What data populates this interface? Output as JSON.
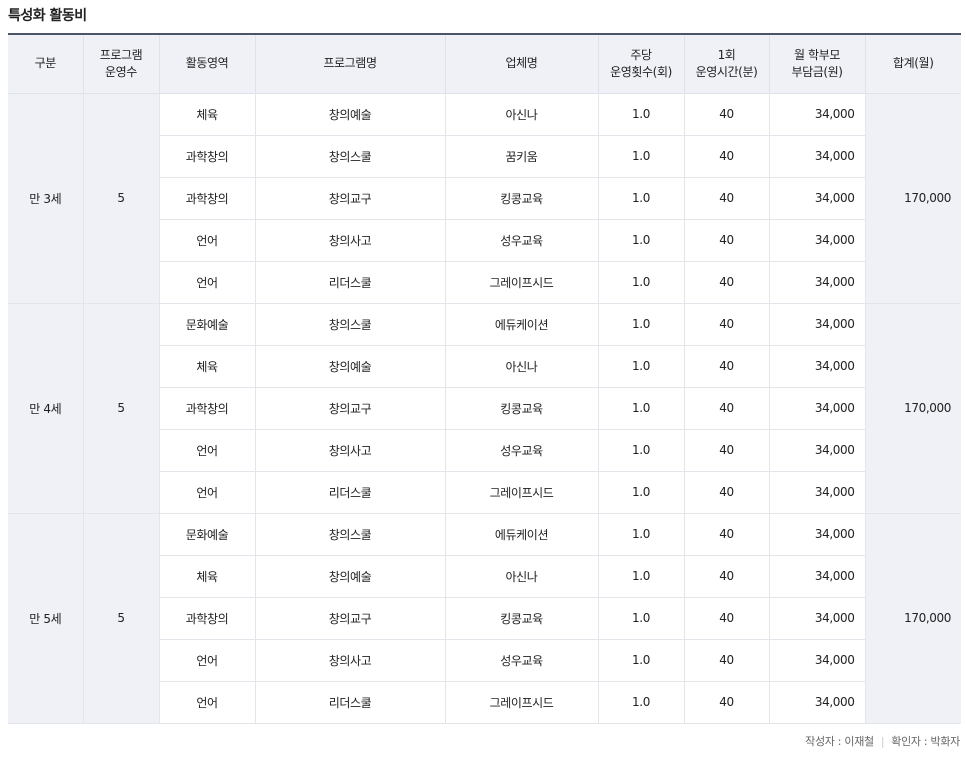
{
  "title": "특성화 활동비",
  "headers": {
    "gubun": "구분",
    "prog_count": [
      "프로그램",
      "운영수"
    ],
    "area": "활동영역",
    "program": "프로그램명",
    "vendor": "업체명",
    "weekly": [
      "주당",
      "운영횟수(회)"
    ],
    "duration": [
      "1회",
      "운영시간(분)"
    ],
    "fee": [
      "월 학부모",
      "부담금(원)"
    ],
    "total": "합계(월)"
  },
  "groups": [
    {
      "label": "만 3세",
      "count": "5",
      "total": "170,000",
      "rows": [
        {
          "area": "체육",
          "program": "창의예술",
          "vendor": "아신나",
          "weekly": "1.0",
          "duration": "40",
          "fee": "34,000"
        },
        {
          "area": "과학창의",
          "program": "창의스쿨",
          "vendor": "꿈키움",
          "weekly": "1.0",
          "duration": "40",
          "fee": "34,000"
        },
        {
          "area": "과학창의",
          "program": "창의교구",
          "vendor": "킹콩교육",
          "weekly": "1.0",
          "duration": "40",
          "fee": "34,000"
        },
        {
          "area": "언어",
          "program": "창의사고",
          "vendor": "성우교육",
          "weekly": "1.0",
          "duration": "40",
          "fee": "34,000"
        },
        {
          "area": "언어",
          "program": "리더스쿨",
          "vendor": "그레이프시드",
          "weekly": "1.0",
          "duration": "40",
          "fee": "34,000"
        }
      ]
    },
    {
      "label": "만 4세",
      "count": "5",
      "total": "170,000",
      "rows": [
        {
          "area": "문화예술",
          "program": "창의스쿨",
          "vendor": "에듀케이션",
          "weekly": "1.0",
          "duration": "40",
          "fee": "34,000"
        },
        {
          "area": "체육",
          "program": "창의예술",
          "vendor": "아신나",
          "weekly": "1.0",
          "duration": "40",
          "fee": "34,000"
        },
        {
          "area": "과학창의",
          "program": "창의교구",
          "vendor": "킹콩교육",
          "weekly": "1.0",
          "duration": "40",
          "fee": "34,000"
        },
        {
          "area": "언어",
          "program": "창의사고",
          "vendor": "성우교육",
          "weekly": "1.0",
          "duration": "40",
          "fee": "34,000"
        },
        {
          "area": "언어",
          "program": "리더스쿨",
          "vendor": "그레이프시드",
          "weekly": "1.0",
          "duration": "40",
          "fee": "34,000"
        }
      ]
    },
    {
      "label": "만 5세",
      "count": "5",
      "total": "170,000",
      "rows": [
        {
          "area": "문화예술",
          "program": "창의스쿨",
          "vendor": "에듀케이션",
          "weekly": "1.0",
          "duration": "40",
          "fee": "34,000"
        },
        {
          "area": "체육",
          "program": "창의예술",
          "vendor": "아신나",
          "weekly": "1.0",
          "duration": "40",
          "fee": "34,000"
        },
        {
          "area": "과학창의",
          "program": "창의교구",
          "vendor": "킹콩교육",
          "weekly": "1.0",
          "duration": "40",
          "fee": "34,000"
        },
        {
          "area": "언어",
          "program": "창의사고",
          "vendor": "성우교육",
          "weekly": "1.0",
          "duration": "40",
          "fee": "34,000"
        },
        {
          "area": "언어",
          "program": "리더스쿨",
          "vendor": "그레이프시드",
          "weekly": "1.0",
          "duration": "40",
          "fee": "34,000"
        }
      ]
    }
  ],
  "footer": {
    "author": "작성자 : 이재철",
    "checker": "확인자 : 박화자"
  }
}
